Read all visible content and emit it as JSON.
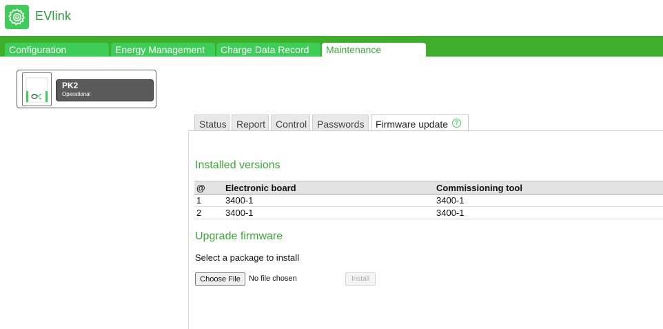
{
  "app": {
    "title": "EVlink",
    "logo_icon": "gear-plug-icon",
    "brand_color": "#3dcd58"
  },
  "nav": {
    "tabs": [
      {
        "label": "Configuration",
        "active": false
      },
      {
        "label": "Energy Management",
        "active": false
      },
      {
        "label": "Charge Data Record",
        "active": false
      },
      {
        "label": "Maintenance",
        "active": true
      }
    ]
  },
  "station": {
    "name": "PK2",
    "status": "Operational",
    "icon": "charging-station-icon"
  },
  "subtabs": [
    {
      "label": "Status",
      "active": false
    },
    {
      "label": "Report",
      "active": false
    },
    {
      "label": "Control",
      "active": false
    },
    {
      "label": "Passwords",
      "active": false
    },
    {
      "label": "Firmware update",
      "active": true
    }
  ],
  "help": {
    "glyph": "?"
  },
  "installed": {
    "title": "Installed versions",
    "columns": [
      "@",
      "Electronic board",
      "Commissioning tool"
    ],
    "rows": [
      [
        "1",
        "3400-1",
        "3400-1"
      ],
      [
        "2",
        "3400-1",
        "3400-1"
      ]
    ]
  },
  "upgrade": {
    "title": "Upgrade firmware",
    "select_label": "Select a package to install",
    "choose_file_label": "Choose File",
    "no_file_text": "No file chosen",
    "install_label": "Install"
  }
}
